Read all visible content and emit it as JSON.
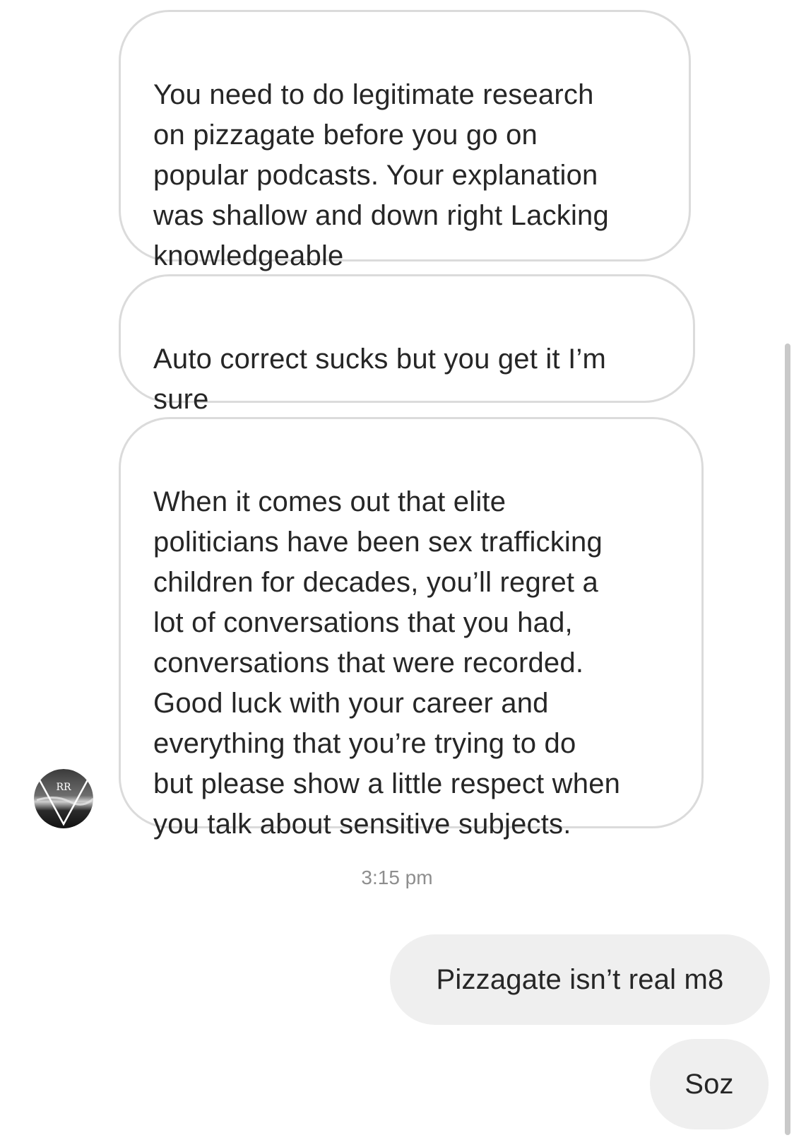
{
  "conversation": {
    "incoming": [
      {
        "text": "You need to do legitimate research\non pizzagate before you go on\npopular podcasts. Your explanation\nwas shallow and down right Lacking\nknowledgeable"
      },
      {
        "text": "Auto correct sucks but you get it I’m\nsure"
      },
      {
        "text": "When it comes out that elite\npoliticians have been sex trafficking\nchildren for decades, you’ll regret a\nlot of conversations that you had,\nconversations that were recorded.\nGood luck with your career and\neverything that you’re trying to do\nbut please show a little respect when\nyou talk about sensitive subjects."
      }
    ],
    "timestamp": "3:15 pm",
    "outgoing": [
      {
        "text": "Pizzagate isn’t real m8"
      },
      {
        "text": "Soz"
      }
    ],
    "sender_avatar": {
      "icon": "profile-avatar-icon",
      "logo_text": "RR"
    }
  },
  "colors": {
    "incoming_border": "#dbdbdb",
    "outgoing_bg": "#efefef",
    "text": "#262626",
    "timestamp": "#8e8e8e"
  }
}
